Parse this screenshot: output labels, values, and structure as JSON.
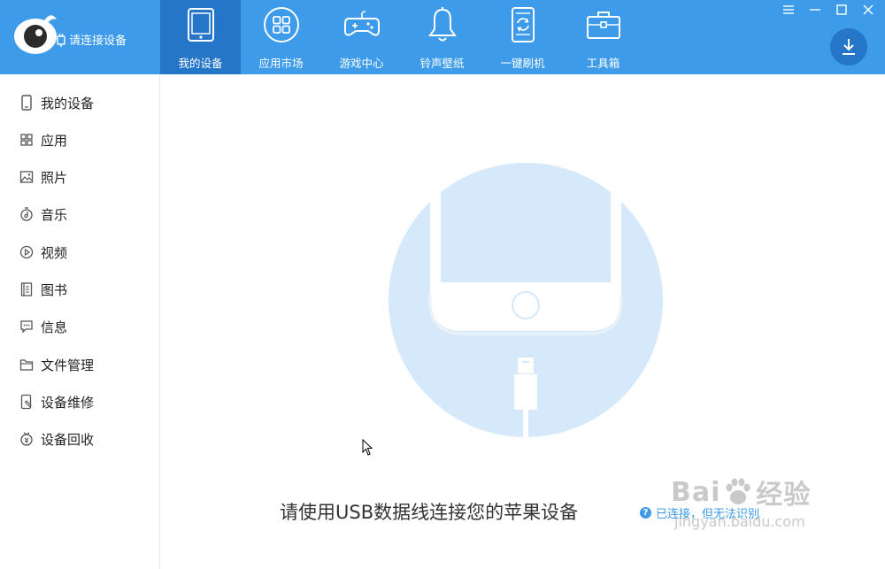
{
  "header": {
    "connect_label": "请连接设备",
    "nav": [
      {
        "label": "我的设备",
        "icon": "tablet-icon",
        "active": true
      },
      {
        "label": "应用市场",
        "icon": "apps-grid-icon"
      },
      {
        "label": "游戏中心",
        "icon": "gamepad-icon"
      },
      {
        "label": "铃声壁纸",
        "icon": "bell-icon"
      },
      {
        "label": "一键刷机",
        "icon": "phone-refresh-icon"
      },
      {
        "label": "工具箱",
        "icon": "toolbox-icon"
      }
    ],
    "window_controls": [
      "menu-icon",
      "minimize-icon",
      "maximize-icon",
      "close-icon"
    ],
    "download_icon": "download-icon"
  },
  "sidebar": {
    "items": [
      {
        "label": "我的设备",
        "icon": "phone-icon"
      },
      {
        "label": "应用",
        "icon": "apps-icon"
      },
      {
        "label": "照片",
        "icon": "photo-icon"
      },
      {
        "label": "音乐",
        "icon": "music-icon"
      },
      {
        "label": "视频",
        "icon": "video-icon"
      },
      {
        "label": "图书",
        "icon": "book-icon"
      },
      {
        "label": "信息",
        "icon": "message-icon"
      },
      {
        "label": "文件管理",
        "icon": "folder-icon"
      },
      {
        "label": "设备维修",
        "icon": "repair-icon"
      },
      {
        "label": "设备回收",
        "icon": "recycle-icon"
      }
    ]
  },
  "main": {
    "prompt": "请使用USB数据线连接您的苹果设备",
    "help_link": "已连接，但无法识别"
  },
  "watermark": {
    "brand": "Bai",
    "brand_suffix": "经验",
    "url": "jingyan.baidu.com"
  },
  "colors": {
    "header_bg": "#3d9be9",
    "active_tab": "#2576c8",
    "illustration_bg": "#d6e9fa"
  }
}
